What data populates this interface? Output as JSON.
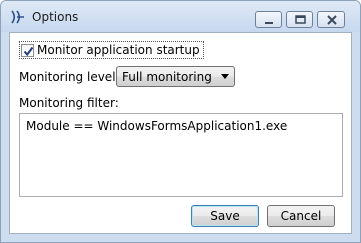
{
  "window": {
    "title": "Options",
    "icon": "app-icon",
    "controls": [
      "minimize-icon",
      "maximize-icon",
      "close-icon"
    ]
  },
  "monitor_startup": {
    "label": "Monitor application startup",
    "checked": true
  },
  "monitoring_level": {
    "label": "Monitoring level:",
    "value": "Full monitoring"
  },
  "monitoring_filter": {
    "label": "Monitoring filter:",
    "value": "Module == WindowsFormsApplication1.exe"
  },
  "buttons": {
    "save": "Save",
    "cancel": "Cancel"
  }
}
